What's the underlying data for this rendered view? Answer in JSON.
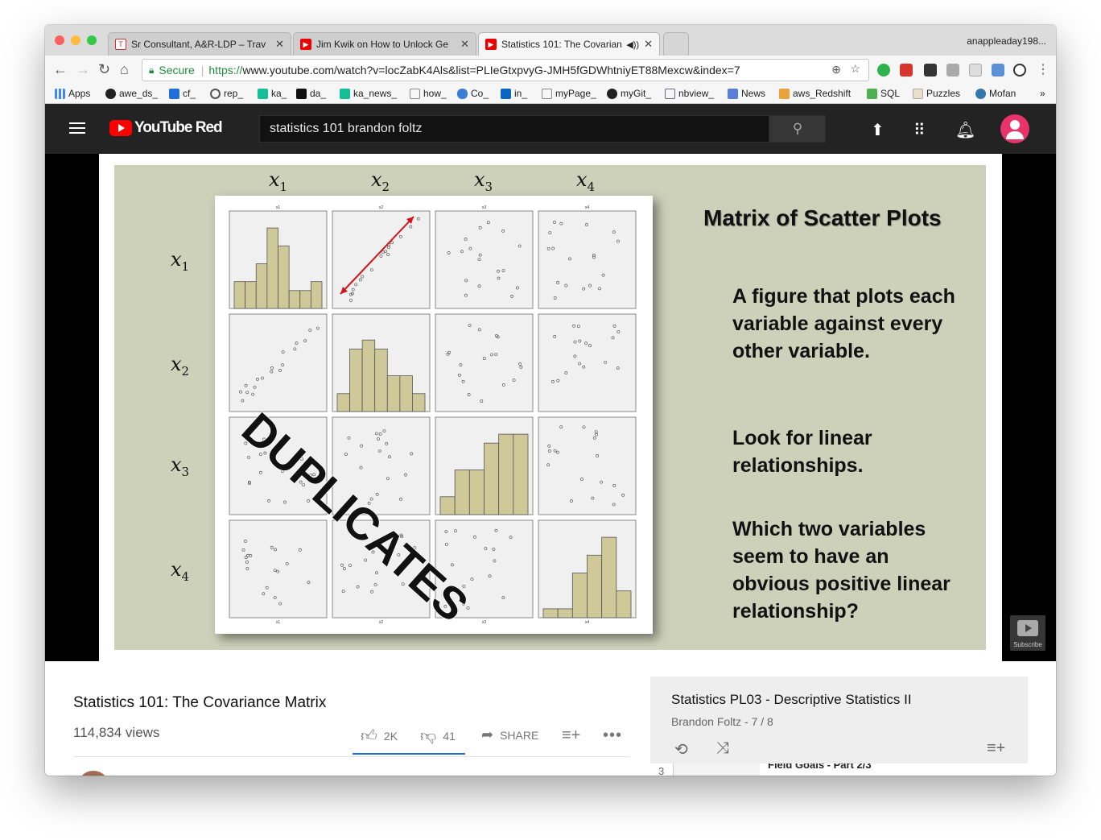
{
  "browser": {
    "tabs": [
      {
        "label": "Sr Consultant, A&R-LDP – Trav",
        "favicon": "teal-t-icon"
      },
      {
        "label": "Jim Kwik on How to Unlock Ge",
        "favicon": "youtube-icon"
      },
      {
        "label": "Statistics 101: The Covarian",
        "favicon": "youtube-icon",
        "active": true
      }
    ],
    "profile": "anappleaday198...",
    "secure_label": "Secure",
    "url_scheme": "https://",
    "url_rest": "www.youtube.com/watch?v=locZabK4Als&list=PLIeGtxpvyG-JMH5fGDWhtniyET88Mexcw&index=7",
    "bookmarks": [
      "Apps",
      "awe_ds_",
      "cf_",
      "rep_",
      "ka_",
      "da_",
      "ka_news_",
      "how_",
      "Co_",
      "in_",
      "myPage_",
      "myGit_",
      "nbview_",
      "News",
      "aws_Redshift",
      "SQL",
      "Puzzles",
      "Mofan"
    ],
    "bookmarks_more": "»"
  },
  "youtube": {
    "brand": "YouTube Red",
    "search_value": "statistics 101 brandon foltz"
  },
  "slide": {
    "col_vars": [
      "x",
      "x",
      "x",
      "x"
    ],
    "col_subs": [
      "1",
      "2",
      "3",
      "4"
    ],
    "title": "Matrix of Scatter Plots",
    "para1": "A figure that plots each variable against every other variable.",
    "para2": "Look for linear relationships.",
    "para3": "Which two variables seem to have an obvious positive linear relationship?",
    "stamp": "DUPLICATES",
    "cell_labels": [
      "x1",
      "x2",
      "x3",
      "x4"
    ],
    "histograms": {
      "x1": [
        3,
        3,
        5,
        9,
        7,
        2,
        2,
        3
      ],
      "x2": [
        2,
        7,
        8,
        7,
        4,
        4,
        2
      ],
      "x3": [
        2,
        5,
        5,
        8,
        9,
        9
      ],
      "x4": [
        1,
        1,
        5,
        7,
        9,
        3
      ]
    }
  },
  "subscribe_label": "Subscribe",
  "video": {
    "title": "Statistics 101: The Covariance Matrix",
    "views": "114,834 views",
    "likes": "2K",
    "dislikes": "41",
    "share": "SHARE"
  },
  "playlist": {
    "title": "Statistics PL03 - Descriptive Statistics II",
    "subtitle": "Brandon Foltz - 7 / 8",
    "next_index": "3",
    "next_title": "Field Goals - Part 2/3"
  }
}
